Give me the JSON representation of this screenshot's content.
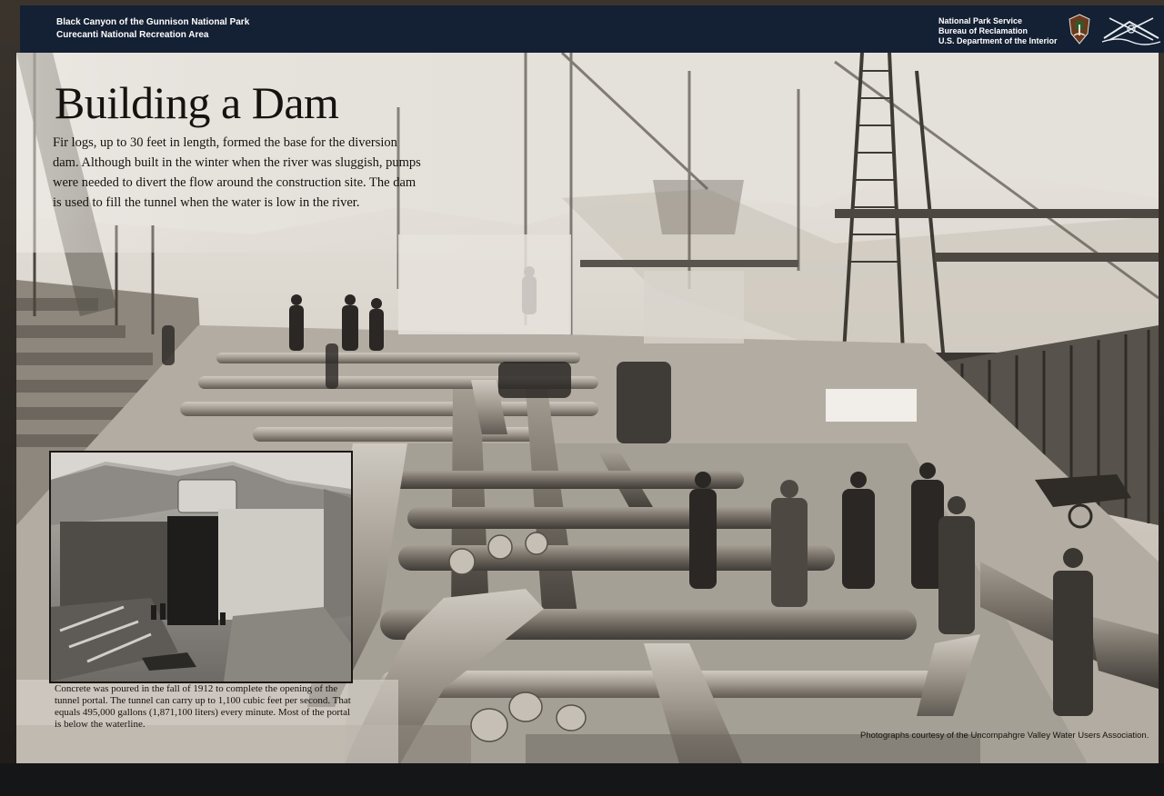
{
  "header": {
    "park_name": "Black Canyon of the Gunnison National Park",
    "area_name": "Curecanti National Recreation Area",
    "agency_1": "National Park Service",
    "agency_2": "Bureau of Reclamation",
    "agency_3": "U.S. Department of the Interior"
  },
  "sign": {
    "title": "Building a Dam",
    "body": "Fir logs, up to 30 feet in length, formed the base for the diversion dam.  Although built in the winter when the river was sluggish, pumps were needed to divert the flow around the construction site. The dam is used to fill the tunnel when the water is low in the river.",
    "inset_caption": "Concrete was poured in the fall of 1912 to complete the opening of the tunnel portal. The tunnel can carry up to 1,100 cubic feet per second. That equals 495,000 gallons (1,871,100 liters) every minute. Most of the portal is below the waterline.",
    "credit": "Photographs courtesy of the Uncompahgre Valley Water Users Association."
  },
  "colors": {
    "header_bg": "#142033",
    "panel_tone": "#ddd8d0",
    "text": "#15120f"
  },
  "icons": [
    "nps-arrowhead-icon",
    "bureau-reclamation-logo-icon"
  ]
}
